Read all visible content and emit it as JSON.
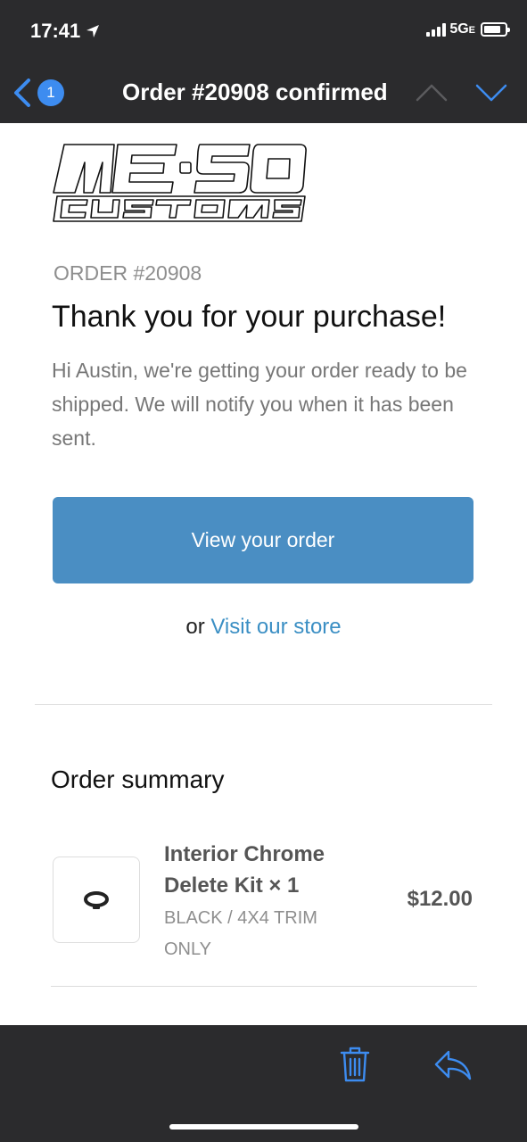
{
  "status_bar": {
    "time": "17:41",
    "network_main": "5G",
    "network_suffix": "E"
  },
  "nav": {
    "badge_count": "1",
    "title": "Order #20908 confirmed"
  },
  "email": {
    "logo_text": "ME-SO CUSTOMS",
    "order_label": "ORDER #20908",
    "headline": "Thank you for your purchase!",
    "intro": "Hi Austin, we're getting your order ready to be shipped. We will notify you when it has been sent.",
    "cta_label": "View your order",
    "secondary_prefix": "or",
    "secondary_link": "Visit our store"
  },
  "summary": {
    "title": "Order summary",
    "items": [
      {
        "name": "Interior Chrome Delete Kit × 1",
        "variant": "BLACK / 4X4 TRIM ONLY",
        "price": "$12.00"
      }
    ]
  },
  "colors": {
    "bar_bg": "#2b2b2d",
    "accent_blue": "#3d8cf0",
    "cta_bg": "#4a8ec3",
    "link": "#3b8fc4"
  }
}
